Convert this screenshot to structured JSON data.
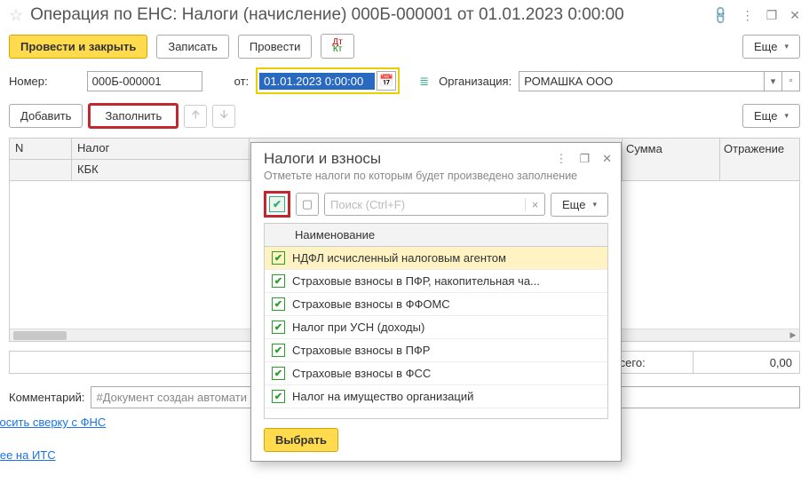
{
  "header": {
    "title": "Операция по ЕНС: Налоги (начисление) 000Б-000001 от 01.01.2023 0:00:00"
  },
  "toolbar": {
    "post_close": "Провести и закрыть",
    "write": "Записать",
    "post": "Провести",
    "more": "Еще"
  },
  "form": {
    "number_label": "Номер:",
    "number_value": "000Б-000001",
    "from_label": "от:",
    "date_value": "01.01.2023  0:00:00",
    "org_label": "Организация:",
    "org_value": "РОМАШКА ООО"
  },
  "subtoolbar": {
    "add": "Добавить",
    "fill": "Заполнить",
    "more": "Еще"
  },
  "grid": {
    "col_n": "N",
    "col_tax": "Налог",
    "col_kbk": "КБК",
    "col_sum": "Сумма",
    "col_refl": "Отражение"
  },
  "totals": {
    "label": "Всего:",
    "value": "0,00"
  },
  "comment": {
    "label": "Комментарий:",
    "value": "#Документ создан автомати"
  },
  "links": {
    "fns": "апросить сверку с ФНС",
    "its": "обнее на ИТС"
  },
  "popup": {
    "title": "Налоги и взносы",
    "subtitle": "Отметьте налоги по которым будет произведено заполнение",
    "search_placeholder": "Поиск (Ctrl+F)",
    "more": "Еще",
    "list_header": "Наименование",
    "items": [
      {
        "name": "НДФЛ исчисленный налоговым агентом",
        "checked": true,
        "selected": true
      },
      {
        "name": "Страховые взносы в ПФР, накопительная ча...",
        "checked": true
      },
      {
        "name": "Страховые взносы в ФФОМС",
        "checked": true
      },
      {
        "name": "Налог при УСН (доходы)",
        "checked": true
      },
      {
        "name": "Страховые взносы в ПФР",
        "checked": true
      },
      {
        "name": "Страховые взносы в ФСС",
        "checked": true
      },
      {
        "name": "Налог на имущество организаций",
        "checked": true
      }
    ],
    "select": "Выбрать"
  }
}
